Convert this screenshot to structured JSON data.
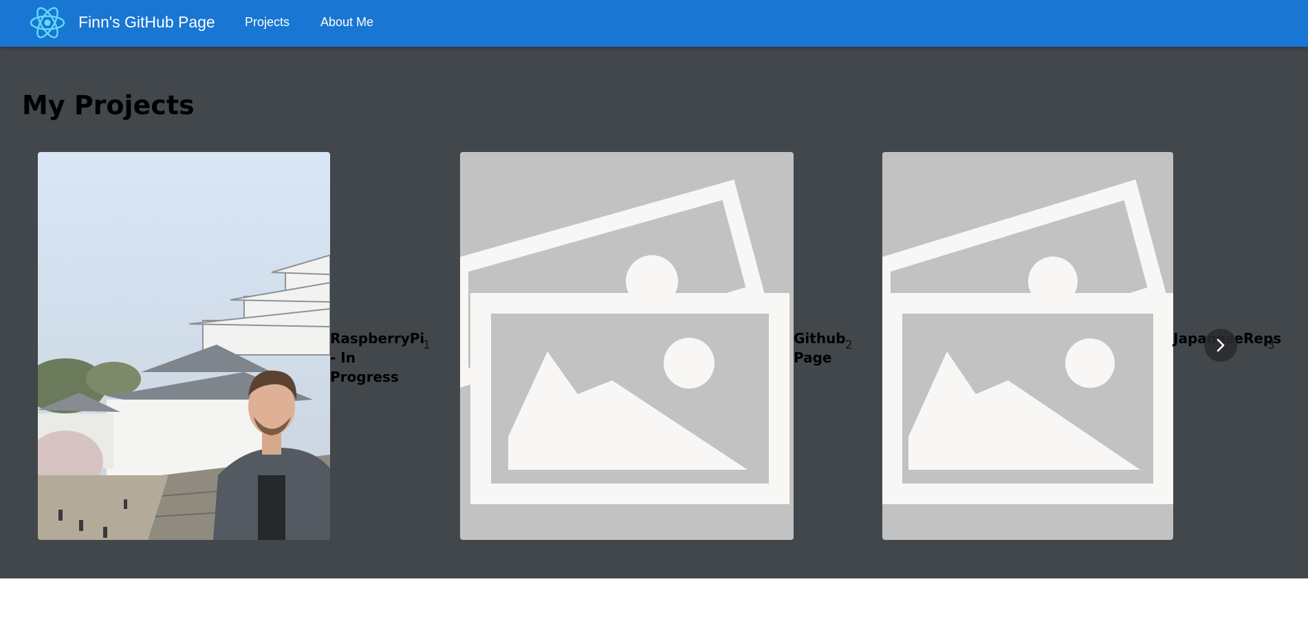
{
  "navbar": {
    "logo_icon": "react-atom-icon",
    "title": "Finn's GitHub Page",
    "links": [
      "Projects",
      "About Me"
    ]
  },
  "main": {
    "heading": "My Projects",
    "projects": [
      {
        "title": "RaspberryPi - In Progress",
        "number": "1",
        "image": "photo-person-at-castle"
      },
      {
        "title": "Github Page",
        "number": "2",
        "image": "image-placeholder-icon"
      },
      {
        "title": "JapaneseReps",
        "number": "3",
        "image": "image-placeholder-icon"
      }
    ],
    "next_icon": "chevron-right-icon"
  },
  "colors": {
    "navbar": "#1976d2",
    "background": "#42474c",
    "placeholder_bg": "#c2c2c2",
    "placeholder_fg": "#f8f7f5",
    "logo": "#61dafb"
  }
}
